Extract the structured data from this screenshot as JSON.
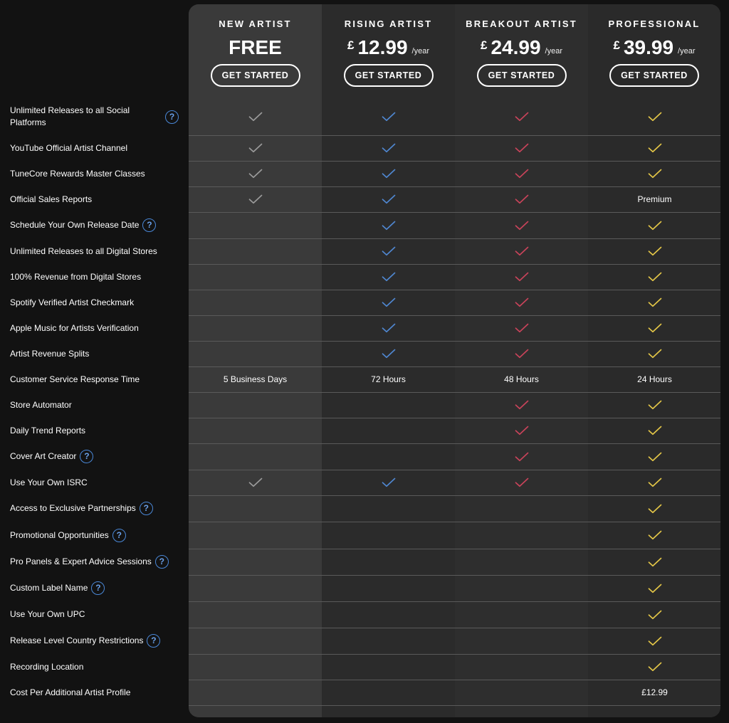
{
  "plans": [
    {
      "name": "NEW ARTIST",
      "currency": "",
      "amount": "FREE",
      "period": "",
      "cta": "GET STARTED",
      "check_color": "#9a9a9a"
    },
    {
      "name": "RISING ARTIST",
      "currency": "£",
      "amount": "12.99",
      "period": "/year",
      "cta": "GET STARTED",
      "check_color": "#4f86cf"
    },
    {
      "name": "BREAKOUT ARTIST",
      "currency": "£",
      "amount": "24.99",
      "period": "/year",
      "cta": "GET STARTED",
      "check_color": "#c8435a"
    },
    {
      "name": "PROFESSIONAL",
      "currency": "£",
      "amount": "39.99",
      "period": "/year",
      "cta": "GET STARTED",
      "check_color": "#e2c547"
    }
  ],
  "features": [
    {
      "label": "Unlimited Releases to all Social Platforms",
      "help": true,
      "cells": [
        "check",
        "check",
        "check",
        "check"
      ]
    },
    {
      "label": "YouTube Official Artist Channel",
      "help": false,
      "cells": [
        "check",
        "check",
        "check",
        "check"
      ]
    },
    {
      "label": "TuneCore Rewards Master Classes",
      "help": false,
      "cells": [
        "check",
        "check",
        "check",
        "check"
      ]
    },
    {
      "label": "Official Sales Reports",
      "help": false,
      "cells": [
        "check",
        "check",
        "check",
        "Premium"
      ]
    },
    {
      "label": "Schedule Your Own Release Date",
      "help": true,
      "cells": [
        "",
        "check",
        "check",
        "check"
      ]
    },
    {
      "label": "Unlimited Releases to all Digital Stores",
      "help": false,
      "cells": [
        "",
        "check",
        "check",
        "check"
      ]
    },
    {
      "label": "100% Revenue from Digital Stores",
      "help": false,
      "cells": [
        "",
        "check",
        "check",
        "check"
      ]
    },
    {
      "label": "Spotify Verified Artist Checkmark",
      "help": false,
      "cells": [
        "",
        "check",
        "check",
        "check"
      ]
    },
    {
      "label": "Apple Music for Artists Verification",
      "help": false,
      "cells": [
        "",
        "check",
        "check",
        "check"
      ]
    },
    {
      "label": "Artist Revenue Splits",
      "help": false,
      "cells": [
        "",
        "check",
        "check",
        "check"
      ]
    },
    {
      "label": "Customer Service Response Time",
      "help": false,
      "cells": [
        "5 Business Days",
        "72 Hours",
        "48 Hours",
        "24 Hours"
      ]
    },
    {
      "label": "Store Automator",
      "help": false,
      "cells": [
        "",
        "",
        "check",
        "check"
      ]
    },
    {
      "label": "Daily Trend Reports",
      "help": false,
      "cells": [
        "",
        "",
        "check",
        "check"
      ]
    },
    {
      "label": "Cover Art Creator",
      "help": true,
      "cells": [
        "",
        "",
        "check",
        "check"
      ]
    },
    {
      "label": "Use Your Own ISRC",
      "help": false,
      "cells": [
        "check",
        "check",
        "check",
        "check"
      ]
    },
    {
      "label": "Access to Exclusive Partnerships",
      "help": true,
      "cells": [
        "",
        "",
        "",
        "check"
      ]
    },
    {
      "label": "Promotional Opportunities",
      "help": true,
      "cells": [
        "",
        "",
        "",
        "check"
      ]
    },
    {
      "label": "Pro Panels & Expert Advice Sessions",
      "help": true,
      "cells": [
        "",
        "",
        "",
        "check"
      ]
    },
    {
      "label": "Custom Label Name",
      "help": true,
      "cells": [
        "",
        "",
        "",
        "check"
      ]
    },
    {
      "label": "Use Your Own UPC",
      "help": false,
      "cells": [
        "",
        "",
        "",
        "check"
      ]
    },
    {
      "label": "Release Level Country Restrictions",
      "help": true,
      "cells": [
        "",
        "",
        "",
        "check"
      ]
    },
    {
      "label": "Recording Location",
      "help": false,
      "cells": [
        "",
        "",
        "",
        "check"
      ]
    },
    {
      "label": "Cost Per Additional Artist Profile",
      "help": false,
      "cells": [
        "",
        "",
        "",
        "£12.99"
      ]
    }
  ],
  "help_glyph": "?",
  "icons": {
    "check": "check-icon",
    "help": "question-circle-icon"
  }
}
